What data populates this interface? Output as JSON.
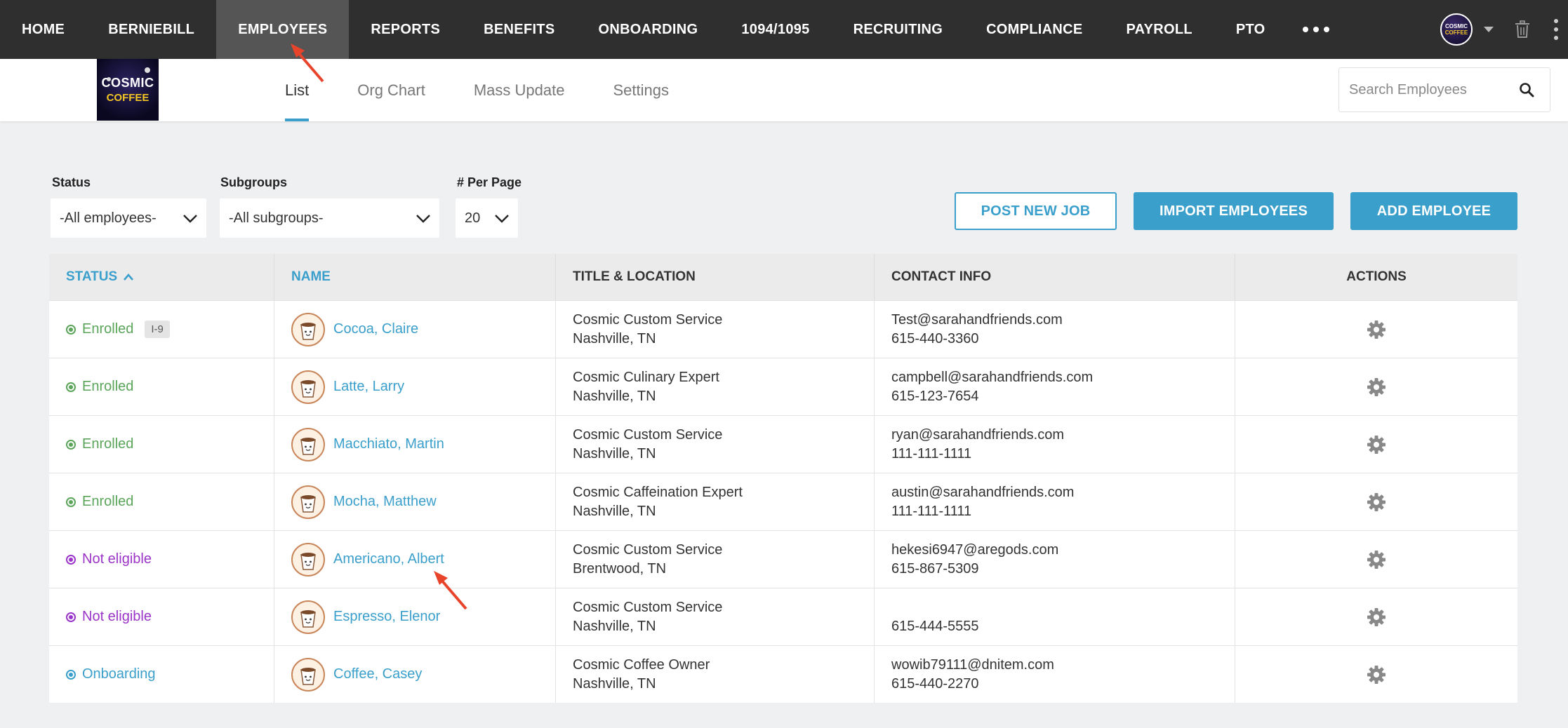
{
  "topnav": {
    "items": [
      "HOME",
      "BERNIEBILL",
      "EMPLOYEES",
      "REPORTS",
      "BENEFITS",
      "ONBOARDING",
      "1094/1095",
      "RECRUITING",
      "COMPLIANCE",
      "PAYROLL",
      "PTO"
    ],
    "active": "EMPLOYEES",
    "avatar_text_1": "COSMIC",
    "avatar_text_2": "COFFEE"
  },
  "logo": {
    "line1": "COSMIC",
    "line2": "COFFEE"
  },
  "subtabs": {
    "items": [
      "List",
      "Org Chart",
      "Mass Update",
      "Settings"
    ],
    "active": "List"
  },
  "search": {
    "placeholder": "Search Employees"
  },
  "filters": {
    "status_label": "Status",
    "status_value": "-All employees-",
    "subgroups_label": "Subgroups",
    "subgroups_value": "-All subgroups-",
    "perpage_label": "# Per Page",
    "perpage_value": "20"
  },
  "buttons": {
    "post_job": "POST NEW JOB",
    "import": "IMPORT EMPLOYEES",
    "add": "ADD EMPLOYEE"
  },
  "table": {
    "headers": {
      "status": "STATUS",
      "name": "NAME",
      "title": "TITLE & LOCATION",
      "contact": "CONTACT INFO",
      "actions": "ACTIONS"
    },
    "rows": [
      {
        "status": "Enrolled",
        "status_type": "enrolled",
        "badge": "I-9",
        "name": "Cocoa, Claire",
        "title": "Cosmic Custom Service",
        "location": "Nashville, TN",
        "email": "Test@sarahandfriends.com",
        "phone": "615-440-3360"
      },
      {
        "status": "Enrolled",
        "status_type": "enrolled",
        "badge": "",
        "name": "Latte, Larry",
        "title": "Cosmic Culinary Expert",
        "location": "Nashville, TN",
        "email": "campbell@sarahandfriends.com",
        "phone": "615-123-7654"
      },
      {
        "status": "Enrolled",
        "status_type": "enrolled",
        "badge": "",
        "name": "Macchiato, Martin",
        "title": "Cosmic Custom Service",
        "location": "Nashville, TN",
        "email": "ryan@sarahandfriends.com",
        "phone": "111-111-1111"
      },
      {
        "status": "Enrolled",
        "status_type": "enrolled",
        "badge": "",
        "name": "Mocha, Matthew",
        "title": "Cosmic Caffeination Expert",
        "location": "Nashville, TN",
        "email": "austin@sarahandfriends.com",
        "phone": "111-111-1111"
      },
      {
        "status": "Not eligible",
        "status_type": "noteligible",
        "badge": "",
        "name": "Americano, Albert",
        "title": "Cosmic Custom Service",
        "location": "Brentwood, TN",
        "email": "hekesi6947@aregods.com",
        "phone": "615-867-5309"
      },
      {
        "status": "Not eligible",
        "status_type": "noteligible",
        "badge": "",
        "name": "Espresso, Elenor",
        "title": "Cosmic Custom Service",
        "location": "Nashville, TN",
        "email": "",
        "phone": "615-444-5555"
      },
      {
        "status": "Onboarding",
        "status_type": "onboarding",
        "badge": "",
        "name": "Coffee, Casey",
        "title": "Cosmic Coffee Owner",
        "location": "Nashville, TN",
        "email": "wowib79111@dnitem.com",
        "phone": "615-440-2270"
      }
    ]
  },
  "colors": {
    "accent": "#3a9fcb",
    "enrolled": "#5aa55a",
    "noteligible": "#9b34c8",
    "onboarding": "#3a9fcb",
    "annotation_arrow": "#e8442c"
  },
  "icons": {
    "search": "search-icon",
    "gear": "gear-icon",
    "trash": "trash-icon",
    "sort": "chevron-up-icon"
  }
}
